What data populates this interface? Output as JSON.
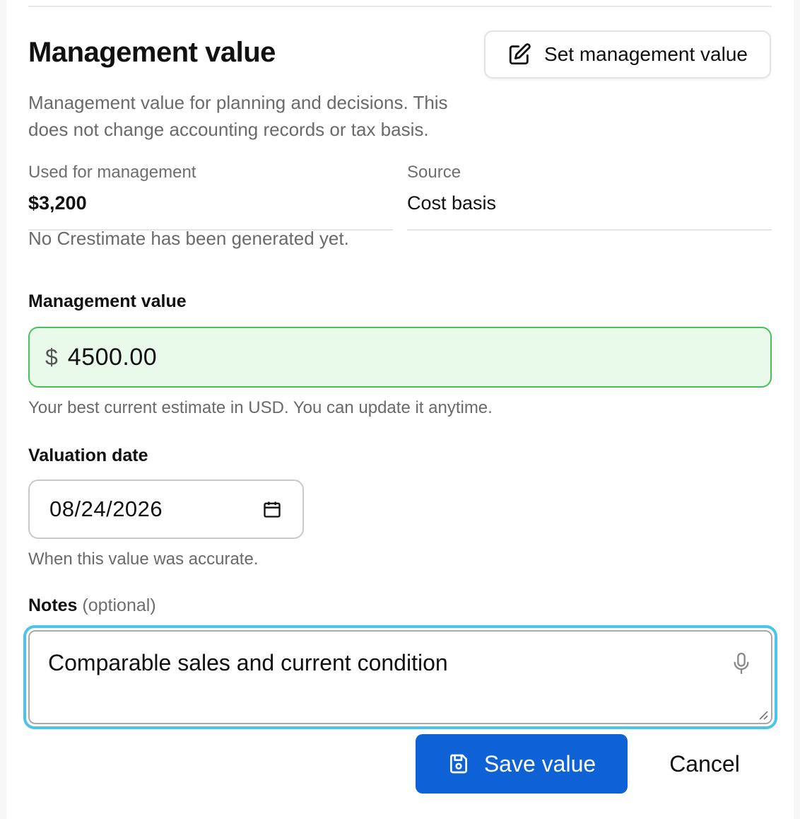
{
  "header": {
    "title": "Management value",
    "set_button_label": "Set management value",
    "description": "Management value for planning and decisions. This does not change accounting records or tax basis."
  },
  "summary": {
    "used_label": "Used for management",
    "used_value": "$3,200",
    "source_label": "Source",
    "source_value": "Cost basis",
    "crestimate_note": "No Crestimate has been generated yet."
  },
  "form": {
    "management_value": {
      "label": "Management value",
      "currency_symbol": "$",
      "value": "4500.00",
      "help": "Your best current estimate in USD. You can update it anytime."
    },
    "valuation_date": {
      "label": "Valuation date",
      "value": "08/24/2026",
      "help": "When this value was accurate."
    },
    "notes": {
      "label": "Notes",
      "optional": "(optional)",
      "value": "Comparable sales and current condition"
    }
  },
  "actions": {
    "save_label": "Save value",
    "cancel_label": "Cancel"
  },
  "colors": {
    "primary": "#0f62d6",
    "valid_border": "#47c25a",
    "valid_fill": "#e9f9ea",
    "focus_ring": "#4cc3ea"
  },
  "icons": {
    "set_button": "pencil-square-icon",
    "date": "calendar-icon",
    "notes": "microphone-icon",
    "save": "floppy-disk-icon"
  }
}
